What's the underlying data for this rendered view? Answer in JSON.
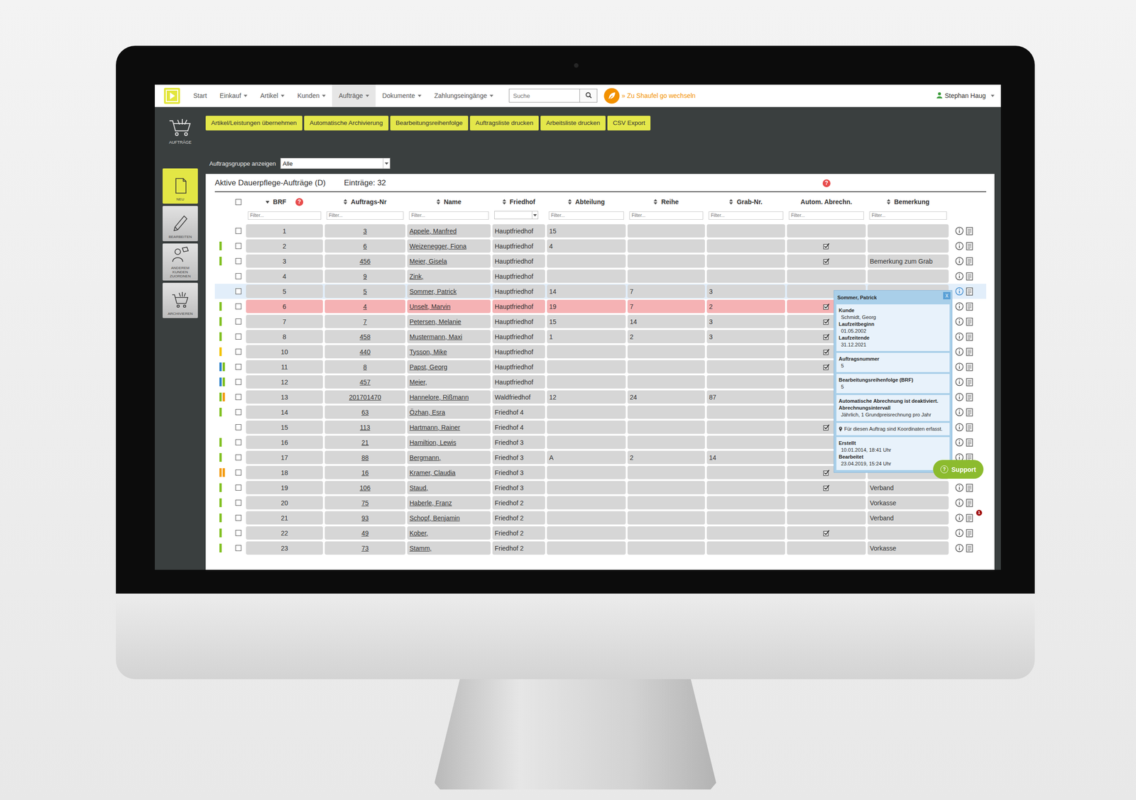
{
  "nav": {
    "menu": [
      {
        "label": "Start",
        "dropdown": false,
        "selected": false
      },
      {
        "label": "Einkauf",
        "dropdown": true,
        "selected": false
      },
      {
        "label": "Artikel",
        "dropdown": true,
        "selected": false
      },
      {
        "label": "Kunden",
        "dropdown": true,
        "selected": false
      },
      {
        "label": "Aufträge",
        "dropdown": true,
        "selected": true
      },
      {
        "label": "Dokumente",
        "dropdown": true,
        "selected": false
      },
      {
        "label": "Zahlungseingänge",
        "dropdown": true,
        "selected": false
      }
    ],
    "search": {
      "placeholder": "Suche"
    },
    "switch_link": "» Zu Shaufel go wechseln",
    "user": {
      "name": "Stephan Haug",
      "dropdown": true
    }
  },
  "sidebar": {
    "module": "AUFTRÄGE",
    "items": [
      {
        "label": "NEU",
        "selected": true
      },
      {
        "label": "BEARBEITEN",
        "selected": false
      },
      {
        "label": "ANDEREM KUNDEN ZUORDNEN",
        "selected": false
      },
      {
        "label": "ARCHIVIEREN",
        "selected": false
      }
    ]
  },
  "toolbar": [
    "Artikel/Leistungen übernehmen",
    "Automatische Archivierung",
    "Bearbeitungsreihenfolge",
    "Auftragsliste drucken",
    "Arbeitsliste drucken",
    "CSV Export"
  ],
  "group_filter": {
    "label": "Auftragsgruppe anzeigen",
    "value": "Alle"
  },
  "table": {
    "title": "Aktive Dauerpflege-Aufträge (D)",
    "count": "Einträge: 32",
    "help": "?",
    "select_all": false,
    "columns": [
      {
        "label": "BRF",
        "sort": "desc",
        "help": "?",
        "filter": "text",
        "placeholder": "Filter..."
      },
      {
        "label": "Auftrags-Nr",
        "sort": "both",
        "filter": "text",
        "placeholder": "Filter..."
      },
      {
        "label": "Name",
        "sort": "both",
        "filter": "text",
        "placeholder": "Filter..."
      },
      {
        "label": "Friedhof",
        "sort": "both",
        "filter": "select"
      },
      {
        "label": "Abteilung",
        "sort": "both",
        "filter": "text",
        "placeholder": "Filter..."
      },
      {
        "label": "Reihe",
        "sort": "both",
        "filter": "text",
        "placeholder": "Filter..."
      },
      {
        "label": "Grab-Nr.",
        "sort": "both",
        "filter": "text",
        "placeholder": "Filter..."
      },
      {
        "label": "Autom. Abrechn.",
        "sort": "none",
        "filter": "text",
        "placeholder": "Filter..."
      },
      {
        "label": "Bemerkung",
        "sort": "both",
        "filter": "text",
        "placeholder": "Filter..."
      }
    ],
    "rows": [
      {
        "brf": "1",
        "nr": "3",
        "name": "Appele, Manfred",
        "friedhof": "Hauptfriedhof",
        "abteilung": "15",
        "reihe": "",
        "grab": "",
        "auto": false,
        "bemerkung": "",
        "selected": false,
        "kind": "normal",
        "markers": [],
        "badge": ""
      },
      {
        "brf": "2",
        "nr": "6",
        "name": "Weizenegger, Fiona",
        "friedhof": "Hauptfriedhof",
        "abteilung": "4",
        "reihe": "",
        "grab": "",
        "auto": true,
        "bemerkung": "",
        "selected": false,
        "kind": "normal",
        "markers": [
          {
            "color": "#7fbf1e"
          }
        ],
        "badge": ""
      },
      {
        "brf": "3",
        "nr": "456",
        "name": "Meier, Gisela",
        "friedhof": "Hauptfriedhof",
        "abteilung": "",
        "reihe": "",
        "grab": "",
        "auto": true,
        "bemerkung": "Bemerkung zum Grab",
        "selected": false,
        "kind": "normal",
        "markers": [
          {
            "color": "#7fbf1e"
          }
        ],
        "badge": ""
      },
      {
        "brf": "4",
        "nr": "9",
        "name": "Zink,",
        "friedhof": "Hauptfriedhof",
        "abteilung": "",
        "reihe": "",
        "grab": "",
        "auto": false,
        "bemerkung": "",
        "selected": false,
        "kind": "normal",
        "markers": [],
        "badge": ""
      },
      {
        "brf": "5",
        "nr": "5",
        "name": "Sommer, Patrick",
        "friedhof": "Hauptfriedhof",
        "abteilung": "14",
        "reihe": "7",
        "grab": "3",
        "auto": false,
        "bemerkung": "",
        "selected": false,
        "kind": "hover",
        "markers": [],
        "badge": ""
      },
      {
        "brf": "6",
        "nr": "4",
        "name": "Unselt, Marvin",
        "friedhof": "Hauptfriedhof",
        "abteilung": "19",
        "reihe": "7",
        "grab": "2",
        "auto": true,
        "bemerkung": "",
        "selected": false,
        "kind": "alert",
        "markers": [
          {
            "color": "#7fbf1e"
          }
        ],
        "badge": ""
      },
      {
        "brf": "7",
        "nr": "7",
        "name": "Petersen, Melanie",
        "friedhof": "Hauptfriedhof",
        "abteilung": "15",
        "reihe": "14",
        "grab": "3",
        "auto": true,
        "bemerkung": "",
        "selected": false,
        "kind": "normal",
        "markers": [
          {
            "color": "#7fbf1e"
          }
        ],
        "badge": ""
      },
      {
        "brf": "8",
        "nr": "458",
        "name": "Mustermann, Maxi",
        "friedhof": "Hauptfriedhof",
        "abteilung": "1",
        "reihe": "2",
        "grab": "3",
        "auto": true,
        "bemerkung": "",
        "selected": false,
        "kind": "normal",
        "markers": [
          {
            "color": "#7fbf1e"
          }
        ],
        "badge": ""
      },
      {
        "brf": "10",
        "nr": "440",
        "name": "Tysson, Mike",
        "friedhof": "Hauptfriedhof",
        "abteilung": "",
        "reihe": "",
        "grab": "",
        "auto": true,
        "bemerkung": "",
        "selected": false,
        "kind": "normal",
        "markers": [
          {
            "color": "#f2c200"
          }
        ],
        "badge": ""
      },
      {
        "brf": "11",
        "nr": "8",
        "name": "Papst, Georg",
        "friedhof": "Hauptfriedhof",
        "abteilung": "",
        "reihe": "",
        "grab": "",
        "auto": true,
        "bemerkung": "",
        "selected": false,
        "kind": "normal",
        "markers": [
          {
            "color": "#2a7fc9"
          },
          {
            "color": "#7fbf1e"
          }
        ],
        "badge": ""
      },
      {
        "brf": "12",
        "nr": "457",
        "name": "Meier,",
        "friedhof": "Hauptfriedhof",
        "abteilung": "",
        "reihe": "",
        "grab": "",
        "auto": false,
        "bemerkung": "",
        "selected": false,
        "kind": "normal",
        "markers": [
          {
            "color": "#2a7fc9"
          },
          {
            "color": "#7fbf1e"
          }
        ],
        "badge": ""
      },
      {
        "brf": "13",
        "nr": "201701470",
        "name": "Hannelore, Rißmann",
        "friedhof": "Waldfriedhof",
        "abteilung": "12",
        "reihe": "24",
        "grab": "87",
        "auto": false,
        "bemerkung": "",
        "selected": false,
        "kind": "normal",
        "markers": [
          {
            "color": "#7fbf1e"
          },
          {
            "color": "#f39c12"
          }
        ],
        "badge": ""
      },
      {
        "brf": "14",
        "nr": "63",
        "name": "Özhan, Esra",
        "friedhof": "Friedhof 4",
        "abteilung": "",
        "reihe": "",
        "grab": "",
        "auto": false,
        "bemerkung": "",
        "selected": false,
        "kind": "normal",
        "markers": [
          {
            "color": "#7fbf1e"
          }
        ],
        "badge": ""
      },
      {
        "brf": "15",
        "nr": "113",
        "name": "Hartmann, Rainer",
        "friedhof": "Friedhof 4",
        "abteilung": "",
        "reihe": "",
        "grab": "",
        "auto": true,
        "bemerkung": "",
        "selected": false,
        "kind": "normal",
        "markers": [],
        "badge": ""
      },
      {
        "brf": "16",
        "nr": "21",
        "name": "Hamiltion, Lewis",
        "friedhof": "Friedhof 3",
        "abteilung": "",
        "reihe": "",
        "grab": "",
        "auto": false,
        "bemerkung": "",
        "selected": false,
        "kind": "normal",
        "markers": [
          {
            "color": "#7fbf1e"
          }
        ],
        "badge": ""
      },
      {
        "brf": "17",
        "nr": "88",
        "name": "Bergmann,",
        "friedhof": "Friedhof 3",
        "abteilung": "A",
        "reihe": "2",
        "grab": "14",
        "auto": false,
        "bemerkung": "",
        "selected": false,
        "kind": "normal",
        "markers": [
          {
            "color": "#7fbf1e"
          }
        ],
        "badge": ""
      },
      {
        "brf": "18",
        "nr": "16",
        "name": "Kramer, Claudia",
        "friedhof": "Friedhof 3",
        "abteilung": "",
        "reihe": "",
        "grab": "",
        "auto": true,
        "bemerkung": "",
        "selected": false,
        "kind": "normal",
        "markers": [
          {
            "color": "#f39c12"
          },
          {
            "color": "#f39c12"
          }
        ],
        "badge": ""
      },
      {
        "brf": "19",
        "nr": "106",
        "name": "Staud,",
        "friedhof": "Friedhof 3",
        "abteilung": "",
        "reihe": "",
        "grab": "",
        "auto": true,
        "bemerkung": "Verband",
        "selected": false,
        "kind": "normal",
        "markers": [
          {
            "color": "#7fbf1e"
          }
        ],
        "badge": ""
      },
      {
        "brf": "20",
        "nr": "75",
        "name": "Haberle, Franz",
        "friedhof": "Friedhof 2",
        "abteilung": "",
        "reihe": "",
        "grab": "",
        "auto": false,
        "bemerkung": "Vorkasse",
        "selected": false,
        "kind": "normal",
        "markers": [
          {
            "color": "#7fbf1e"
          }
        ],
        "badge": ""
      },
      {
        "brf": "21",
        "nr": "93",
        "name": "Schopf, Benjamin",
        "friedhof": "Friedhof 2",
        "abteilung": "",
        "reihe": "",
        "grab": "",
        "auto": false,
        "bemerkung": "Verband",
        "selected": false,
        "kind": "normal",
        "markers": [
          {
            "color": "#7fbf1e"
          }
        ],
        "badge": "1"
      },
      {
        "brf": "22",
        "nr": "49",
        "name": "Kober,",
        "friedhof": "Friedhof 2",
        "abteilung": "",
        "reihe": "",
        "grab": "",
        "auto": true,
        "bemerkung": "",
        "selected": false,
        "kind": "normal",
        "markers": [
          {
            "color": "#7fbf1e"
          }
        ],
        "badge": ""
      },
      {
        "brf": "23",
        "nr": "73",
        "name": "Stamm,",
        "friedhof": "Friedhof 2",
        "abteilung": "",
        "reihe": "",
        "grab": "",
        "auto": false,
        "bemerkung": "Vorkasse",
        "selected": false,
        "kind": "normal",
        "markers": [
          {
            "color": "#7fbf1e"
          }
        ],
        "badge": ""
      }
    ]
  },
  "tooltip": {
    "title": "Sommer, Patrick",
    "close": "X",
    "sections": [
      {
        "lines": [
          {
            "kind": "label",
            "text": "Kunde"
          },
          {
            "kind": "value",
            "text": "Schmidt, Georg"
          },
          {
            "kind": "label",
            "text": "Laufzeitbeginn"
          },
          {
            "kind": "value",
            "text": "01.05.2002"
          },
          {
            "kind": "label",
            "text": "Laufzeitende"
          },
          {
            "kind": "value",
            "text": "31.12.2021"
          }
        ]
      },
      {
        "lines": [
          {
            "kind": "label",
            "text": "Auftragsnummer"
          },
          {
            "kind": "value",
            "text": "5"
          }
        ]
      },
      {
        "lines": [
          {
            "kind": "label",
            "text": "Bearbeitungsreihenfolge (BRF)"
          },
          {
            "kind": "value",
            "text": "5"
          }
        ]
      },
      {
        "lines": [
          {
            "kind": "label",
            "text": "Automatische Abrechnung ist deaktiviert."
          },
          {
            "kind": "label",
            "text": "Abrechnungsintervall"
          },
          {
            "kind": "value",
            "text": "Jährlich, 1 Grundpreisrechnung pro Jahr"
          }
        ]
      },
      {
        "lines": [
          {
            "kind": "pin",
            "text": "Für diesen Auftrag sind Koordinaten erfasst."
          }
        ]
      },
      {
        "lines": [
          {
            "kind": "label",
            "text": "Erstellt"
          },
          {
            "kind": "value",
            "text": "10.01.2014, 18:41 Uhr"
          },
          {
            "kind": "label",
            "text": "Bearbeitet"
          },
          {
            "kind": "value",
            "text": "23.04.2019, 15:24 Uhr"
          }
        ]
      }
    ]
  },
  "support": {
    "icon": "?",
    "label": "Support"
  }
}
